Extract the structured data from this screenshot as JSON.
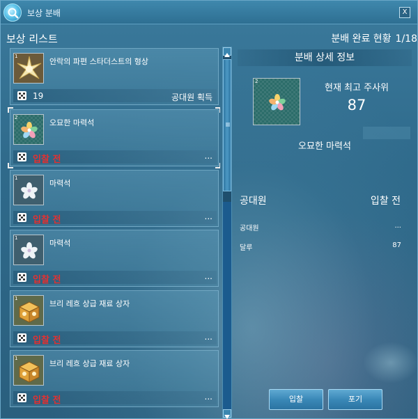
{
  "window": {
    "title": "보상 분배",
    "close_label": "X"
  },
  "header": {
    "list_title": "보상 리스트",
    "status_label": "분배 완료 현황",
    "status_value": "1/18"
  },
  "items": [
    {
      "grade": "1",
      "name": "안락의 파편 스타더스트의 형상",
      "roll": "19",
      "winner": "공대원 획득",
      "bid_status": "",
      "icon": "stardust-icon"
    },
    {
      "grade": "2",
      "name": "오묘한 마력석",
      "roll": "",
      "winner": "...",
      "bid_status": "입찰 전",
      "icon": "mana-stone-icon",
      "selected": true
    },
    {
      "grade": "1",
      "name": "마력석",
      "roll": "",
      "winner": "...",
      "bid_status": "입찰 전",
      "icon": "mana-stone-icon"
    },
    {
      "grade": "1",
      "name": "마력석",
      "roll": "",
      "winner": "...",
      "bid_status": "입찰 전",
      "icon": "mana-stone-icon"
    },
    {
      "grade": "1",
      "name": "브리 레흐 상급 재료 상자",
      "roll": "",
      "winner": "...",
      "bid_status": "입찰 전",
      "icon": "material-box-icon"
    },
    {
      "grade": "1",
      "name": "브리 레흐 상급 재료 상자",
      "roll": "",
      "winner": "...",
      "bid_status": "입찰 전",
      "icon": "material-box-icon"
    }
  ],
  "detail": {
    "header": "분배 상세 정보",
    "grade": "2",
    "highest_label": "현재 최고 주사위",
    "highest_value": "87",
    "item_name": "오묘한 마력석",
    "members_header": "공대원",
    "members_status": "입찰 전",
    "members": [
      {
        "name": "공대원",
        "value": "..."
      },
      {
        "name": "달루",
        "value": "87"
      }
    ]
  },
  "buttons": {
    "bid": "입찰",
    "pass": "포기"
  },
  "colors": {
    "bid_status": "#e53030",
    "panel": "#2f6a8b"
  }
}
